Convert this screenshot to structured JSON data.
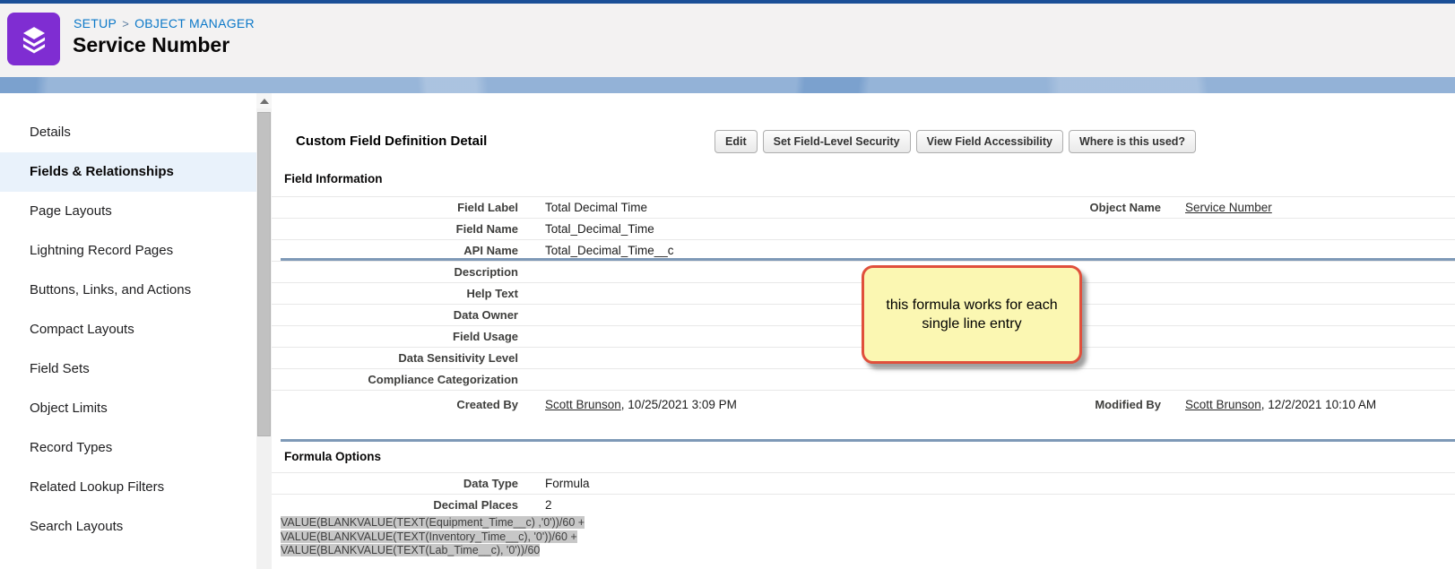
{
  "header": {
    "breadcrumb": {
      "setup": "SETUP",
      "separator": ">",
      "object_manager": "OBJECT MANAGER"
    },
    "title": "Service Number",
    "tile_color": "#7f2dd2"
  },
  "sidebar": {
    "items": [
      {
        "label": "Details",
        "active": false
      },
      {
        "label": "Fields & Relationships",
        "active": true
      },
      {
        "label": "Page Layouts",
        "active": false
      },
      {
        "label": "Lightning Record Pages",
        "active": false
      },
      {
        "label": "Buttons, Links, and Actions",
        "active": false
      },
      {
        "label": "Compact Layouts",
        "active": false
      },
      {
        "label": "Field Sets",
        "active": false
      },
      {
        "label": "Object Limits",
        "active": false
      },
      {
        "label": "Record Types",
        "active": false
      },
      {
        "label": "Related Lookup Filters",
        "active": false
      },
      {
        "label": "Search Layouts",
        "active": false
      }
    ],
    "active_bg": "#e9f2fb"
  },
  "detail": {
    "heading": "Custom Field Definition Detail",
    "buttons": [
      "Edit",
      "Set Field-Level Security",
      "View Field Accessibility",
      "Where is this used?"
    ],
    "field_information": {
      "title": "Field Information",
      "rows": [
        {
          "label": "Field Label",
          "value": "Total Decimal Time"
        },
        {
          "label": "Field Name",
          "value": "Total_Decimal_Time"
        },
        {
          "label": "API Name",
          "value": "Total_Decimal_Time__c"
        },
        {
          "label": "Description",
          "value": ""
        },
        {
          "label": "Help Text",
          "value": ""
        },
        {
          "label": "Data Owner",
          "value": ""
        },
        {
          "label": "Field Usage",
          "value": ""
        },
        {
          "label": "Data Sensitivity Level",
          "value": ""
        },
        {
          "label": "Compliance Categorization",
          "value": ""
        },
        {
          "label": "Created By",
          "link": "Scott Brunson",
          "value_rest": ", 10/25/2021 3:09 PM"
        }
      ],
      "object_name": {
        "label": "Object Name",
        "link": "Service Number"
      },
      "modified_by": {
        "label": "Modified By",
        "link": "Scott Brunson",
        "value_rest": ", 12/2/2021 10:10 AM"
      }
    },
    "formula_options": {
      "title": "Formula Options",
      "rows": [
        {
          "label": "Data Type",
          "value": "Formula"
        },
        {
          "label": "Decimal Places",
          "value": "2"
        }
      ],
      "formula_lines": [
        "VALUE(BLANKVALUE(TEXT(Equipment_Time__c) ,'0'))/60 +",
        "VALUE(BLANKVALUE(TEXT(Inventory_Time__c), '0'))/60 +",
        "VALUE(BLANKVALUE(TEXT(Lab_Time__c), '0'))/60"
      ],
      "highlight_color": "#c7c7c7"
    }
  },
  "note": {
    "line1": "this formula works for each",
    "line2": "single line entry",
    "bg": "#fbf7b2",
    "border": "#e0503c"
  },
  "colors": {
    "topline": "#1a4f97",
    "blue_band": "#7ba1ce",
    "section_rule": "#7e99b7",
    "breadcrumb_link": "#0b78c8"
  }
}
